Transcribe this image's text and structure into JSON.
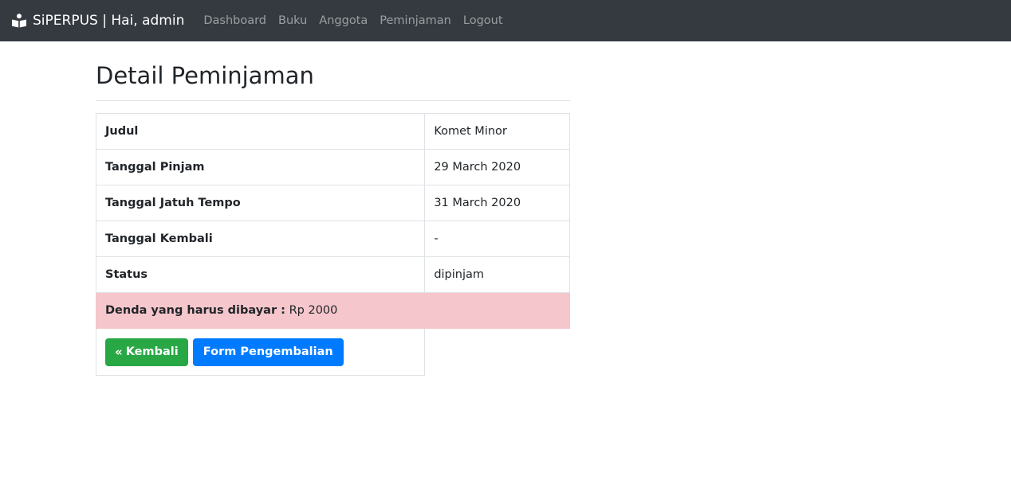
{
  "navbar": {
    "brand": "SiPERPUS | Hai, admin",
    "brand_icon": "book-reader-icon",
    "links": [
      "Dashboard",
      "Buku",
      "Anggota",
      "Peminjaman",
      "Logout"
    ]
  },
  "page": {
    "title": "Detail Peminjaman"
  },
  "details": [
    {
      "label": "Judul",
      "value": "Komet Minor"
    },
    {
      "label": "Tanggal Pinjam",
      "value": "29 March 2020"
    },
    {
      "label": "Tanggal Jatuh Tempo",
      "value": "31 March 2020"
    },
    {
      "label": "Tanggal Kembali",
      "value": "-"
    },
    {
      "label": "Status",
      "value": "dipinjam"
    }
  ],
  "fine": {
    "label": "Denda yang harus dibayar :",
    "value": "Rp 2000"
  },
  "actions": {
    "back_label": "Kembali",
    "back_icon": "angle-double-left-icon",
    "return_form_label": "Form Pengembalian"
  },
  "colors": {
    "navbar_bg": "#343a40",
    "danger_row_bg": "#f5c6cb",
    "success": "#28a745",
    "primary": "#007bff"
  }
}
